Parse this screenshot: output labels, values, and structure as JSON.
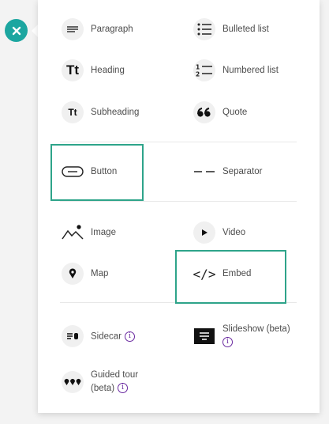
{
  "menu": {
    "group1": [
      {
        "label": "Paragraph",
        "icon": "paragraph-icon"
      },
      {
        "label": "Bulleted list",
        "icon": "bulleted-list-icon"
      },
      {
        "label": "Heading",
        "icon": "heading-icon",
        "glyph": "Tt"
      },
      {
        "label": "Numbered list",
        "icon": "numbered-list-icon"
      },
      {
        "label": "Subheading",
        "icon": "subheading-icon",
        "glyph": "Tt"
      },
      {
        "label": "Quote",
        "icon": "quote-icon",
        "glyph": "❝"
      }
    ],
    "group2": [
      {
        "label": "Button",
        "icon": "button-icon"
      },
      {
        "label": "Separator",
        "icon": "separator-icon"
      }
    ],
    "group3": [
      {
        "label": "Image",
        "icon": "image-icon"
      },
      {
        "label": "Video",
        "icon": "video-icon"
      },
      {
        "label": "Map",
        "icon": "map-pin-icon"
      },
      {
        "label": "Embed",
        "icon": "embed-icon",
        "glyph": "</>"
      }
    ],
    "group4": [
      {
        "label": "Sidecar",
        "icon": "sidecar-icon"
      },
      {
        "label": "Slideshow (beta)",
        "icon": "slideshow-icon"
      },
      {
        "label_line1": "Guided tour",
        "label_line2": "(beta)",
        "icon": "guided-tour-icon"
      }
    ]
  },
  "info_glyph": "i",
  "colors": {
    "accent": "#1ca6a0",
    "highlight": "#2ea48a",
    "info": "#6a2aa0"
  }
}
